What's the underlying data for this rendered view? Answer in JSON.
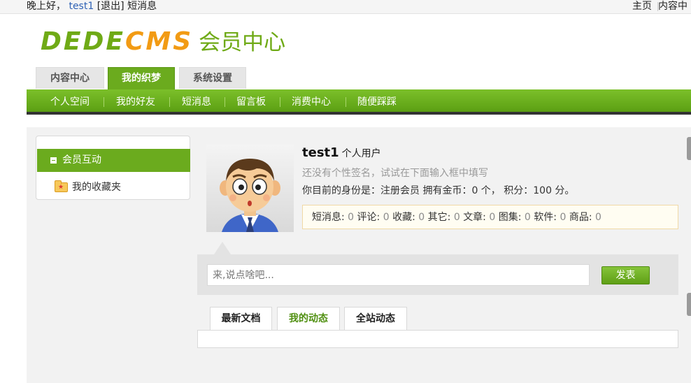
{
  "topbar": {
    "greeting": "晚上好，",
    "username": "test1",
    "logout": "[退出]",
    "messages": "短消息",
    "right_links": [
      "主页",
      "内容中"
    ]
  },
  "logo": {
    "part1": "DEDE",
    "part2": "CMS",
    "suffix": "会员中心"
  },
  "main_tabs": [
    {
      "label": "内容中心",
      "active": false
    },
    {
      "label": "我的织梦",
      "active": true
    },
    {
      "label": "系统设置",
      "active": false
    }
  ],
  "green_nav": [
    "个人空间",
    "我的好友",
    "短消息",
    "留言板",
    "消费中心",
    "随便踩踩"
  ],
  "sidebar": {
    "active_item": "会员互动",
    "items": [
      "我的收藏夹"
    ]
  },
  "profile": {
    "username": "test1",
    "user_type": "个人用户",
    "signature_hint": "还没有个性签名，试试在下面输入框中填写",
    "status": "你目前的身份是：注册会员 拥有金币：0 个， 积分：100 分。",
    "stats": [
      {
        "label": "短消息:",
        "value": "0"
      },
      {
        "label": "评论:",
        "value": "0"
      },
      {
        "label": "收藏:",
        "value": "0"
      },
      {
        "label": "其它:",
        "value": "0"
      },
      {
        "label": "文章:",
        "value": "0"
      },
      {
        "label": "图集:",
        "value": "0"
      },
      {
        "label": "软件:",
        "value": "0"
      },
      {
        "label": "商品:",
        "value": "0"
      }
    ]
  },
  "post": {
    "placeholder": "来,说点啥吧...",
    "button": "发表"
  },
  "lower_tabs": [
    {
      "label": "最新文档",
      "active": false
    },
    {
      "label": "我的动态",
      "active": true
    },
    {
      "label": "全站动态",
      "active": false
    }
  ],
  "colors": {
    "accent": "#6bab1e",
    "link": "#2f62b5",
    "logo_orange": "#f29b14"
  }
}
